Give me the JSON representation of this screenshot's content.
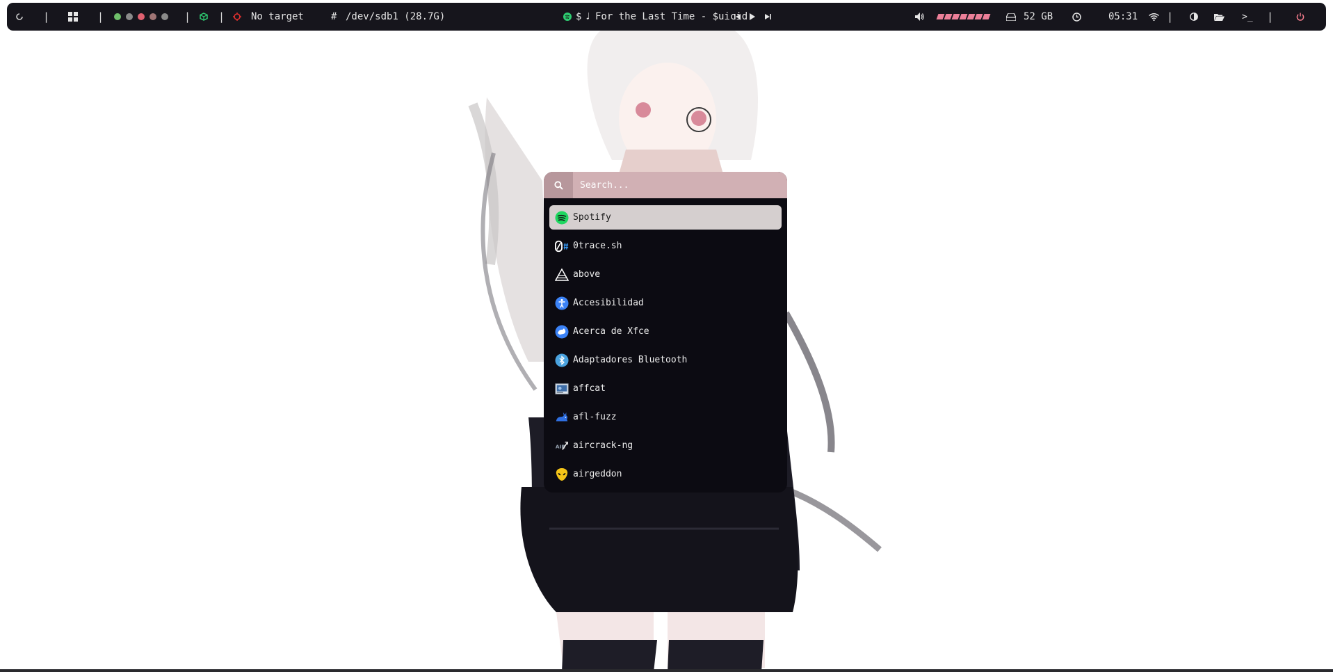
{
  "topbar": {
    "workspaces_title": "No target",
    "target_text": "No target",
    "disk_mount": "/dev/sdb1 (28.7G)",
    "hash_glyph": "#",
    "now_playing": "For the Last Time - $uicid",
    "dollar_glyph": "$",
    "note_glyph": "♩",
    "storage": "52 GB",
    "clock": "05:31",
    "terminal_glyph": ">_",
    "status_colors": {
      "skulls": [
        "#6fbf6a",
        "#7a7a7a",
        "#e06070",
        "#b07070",
        "#8a8a8a"
      ],
      "accent_green": "#2ecc71",
      "target_red": "#e0302e",
      "power_pink": "#f07a8a",
      "volume": "#ec7f98"
    },
    "volume_level": 0.9
  },
  "launcher": {
    "search_placeholder": "Search...",
    "selected_index": 0,
    "items": [
      {
        "label": "Spotify",
        "icon": "spotify-icon"
      },
      {
        "label": "0trace.sh",
        "icon": "0trace-icon"
      },
      {
        "label": "above",
        "icon": "above-icon"
      },
      {
        "label": "Accesibilidad",
        "icon": "accessibility-icon"
      },
      {
        "label": "Acerca de Xfce",
        "icon": "xfce-icon"
      },
      {
        "label": "Adaptadores Bluetooth",
        "icon": "bluetooth-icon"
      },
      {
        "label": "affcat",
        "icon": "affcat-icon"
      },
      {
        "label": "afl-fuzz",
        "icon": "rabbit-icon"
      },
      {
        "label": "aircrack-ng",
        "icon": "aircrack-icon"
      },
      {
        "label": "airgeddon",
        "icon": "alien-icon"
      }
    ]
  }
}
